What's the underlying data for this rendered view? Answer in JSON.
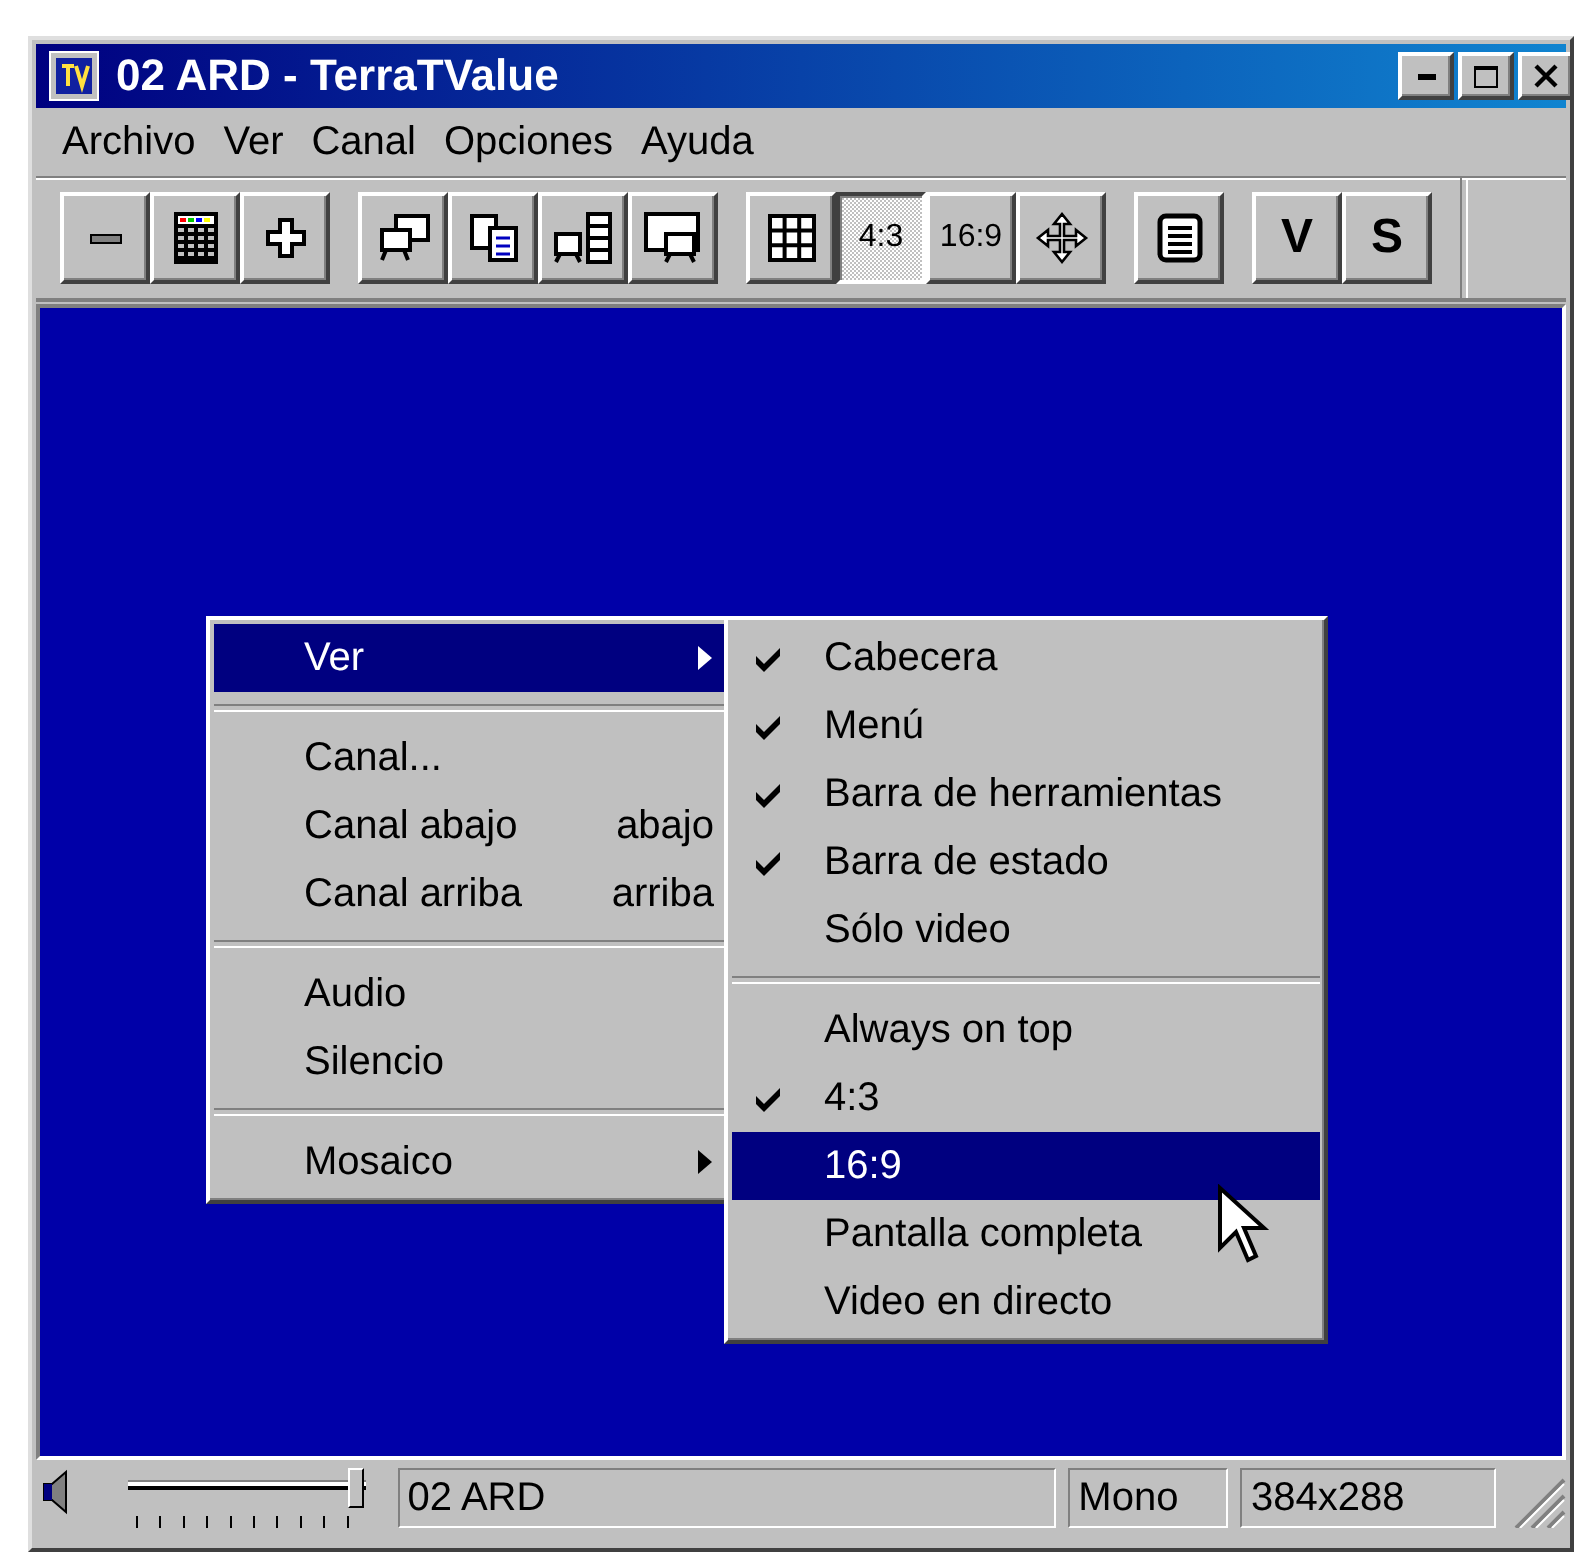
{
  "window": {
    "title": "02 ARD - TerraTValue"
  },
  "menu_bar": [
    {
      "label": "Archivo"
    },
    {
      "label": "Ver"
    },
    {
      "label": "Canal"
    },
    {
      "label": "Opciones"
    },
    {
      "label": "Ayuda"
    }
  ],
  "toolbar": [
    [
      {
        "kind": "icon",
        "pressed": false
      },
      {
        "kind": "icon",
        "pressed": false
      },
      {
        "kind": "icon",
        "pressed": false
      }
    ],
    [
      {
        "kind": "icon",
        "pressed": false
      },
      {
        "kind": "icon",
        "pressed": false
      },
      {
        "kind": "icon",
        "pressed": false
      },
      {
        "kind": "icon",
        "pressed": false
      }
    ],
    [
      {
        "kind": "icon",
        "pressed": false
      },
      {
        "kind": "text",
        "label": "4:3",
        "pressed": true
      },
      {
        "kind": "text",
        "label": "16:9",
        "pressed": false
      },
      {
        "kind": "icon",
        "pressed": false
      }
    ],
    [
      {
        "kind": "icon",
        "pressed": false
      }
    ],
    [
      {
        "kind": "text",
        "label": "V",
        "pressed": false
      },
      {
        "kind": "text",
        "label": "S",
        "pressed": false
      }
    ]
  ],
  "context_menu": [
    {
      "kind": "item",
      "label": "Ver",
      "submenu": true,
      "selected": true
    },
    {
      "kind": "separator"
    },
    {
      "kind": "item",
      "label": "Canal...",
      "submenu": false,
      "selected": false
    },
    {
      "kind": "item",
      "label": "Canal abajo",
      "shortcut": "abajo",
      "submenu": false,
      "selected": false
    },
    {
      "kind": "item",
      "label": "Canal arriba",
      "shortcut": "arriba",
      "submenu": false,
      "selected": false
    },
    {
      "kind": "separator"
    },
    {
      "kind": "item",
      "label": "Audio",
      "submenu": false,
      "selected": false
    },
    {
      "kind": "item",
      "label": "Silencio",
      "submenu": false,
      "selected": false
    },
    {
      "kind": "separator"
    },
    {
      "kind": "item",
      "label": "Mosaico",
      "submenu": true,
      "selected": false
    }
  ],
  "submenu": [
    {
      "kind": "item",
      "label": "Cabecera",
      "checked": true,
      "selected": false
    },
    {
      "kind": "item",
      "label": "Menú",
      "checked": true,
      "selected": false
    },
    {
      "kind": "item",
      "label": "Barra de herramientas",
      "checked": true,
      "selected": false
    },
    {
      "kind": "item",
      "label": "Barra de estado",
      "checked": true,
      "selected": false
    },
    {
      "kind": "item",
      "label": "Sólo video",
      "checked": false,
      "selected": false
    },
    {
      "kind": "separator"
    },
    {
      "kind": "item",
      "label": "Always on top",
      "checked": false,
      "selected": false
    },
    {
      "kind": "item",
      "label": "4:3",
      "checked": true,
      "selected": false
    },
    {
      "kind": "item",
      "label": "16:9",
      "checked": false,
      "selected": true
    },
    {
      "kind": "item",
      "label": "Pantalla completa",
      "checked": false,
      "selected": false
    },
    {
      "kind": "item",
      "label": "Video en directo",
      "checked": false,
      "selected": false
    }
  ],
  "status_bar": {
    "volume": {
      "level": 0.97
    },
    "channel": "02 ARD",
    "audio": "Mono",
    "resolution": "384x288"
  }
}
